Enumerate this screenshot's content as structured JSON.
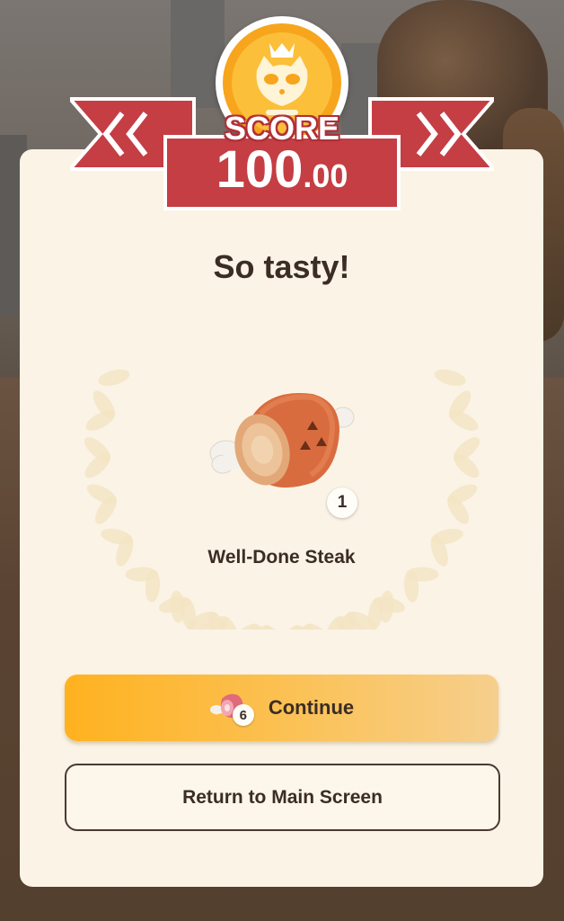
{
  "score": {
    "label": "SCORE",
    "value_int": "100",
    "value_dec": ".00"
  },
  "result": {
    "title": "So tasty!",
    "item_name": "Well-Done Steak",
    "item_quantity": "1"
  },
  "buttons": {
    "continue_label": "Continue",
    "continue_cost": "6",
    "return_label": "Return to Main Screen"
  },
  "colors": {
    "ribbon_red": "#c43e44",
    "card_bg": "#fbf3e6",
    "continue_orange": "#ffb21f",
    "text_dark": "#3b2d24"
  }
}
